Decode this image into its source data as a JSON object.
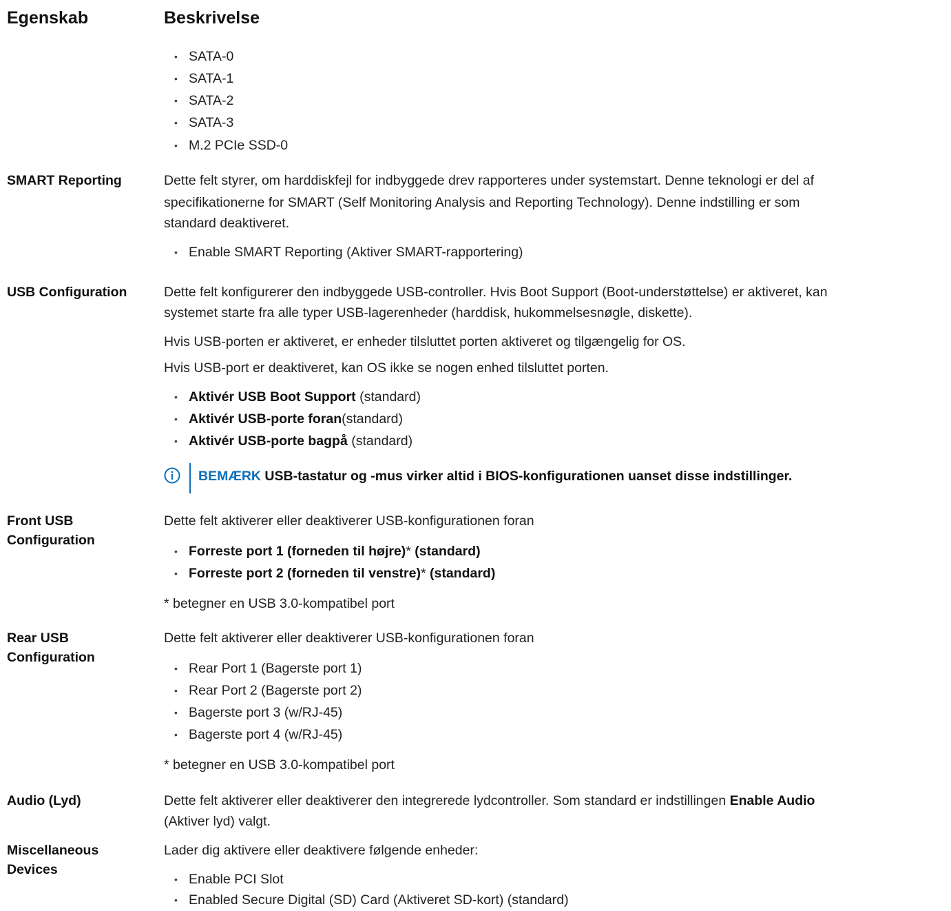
{
  "header": {
    "property": "Egenskab",
    "description": "Beskrivelse"
  },
  "storage_list": [
    "SATA-0",
    "SATA-1",
    "SATA-2",
    "SATA-3",
    "M.2 PCIe SSD-0"
  ],
  "smart": {
    "label": "SMART Reporting",
    "line1": "Dette felt styrer, om harddiskfejl for indbyggede drev rapporteres under systemstart. Denne teknologi er del af",
    "line2": "specifikationerne for SMART (Self Monitoring Analysis and Reporting Technology). Denne indstilling er som",
    "line3": "standard deaktiveret.",
    "option": "Enable SMART Reporting (Aktiver SMART-rapportering)"
  },
  "usb_config": {
    "label": "USB Configuration",
    "line1": "Dette felt konfigurerer den indbyggede USB-controller. Hvis Boot Support (Boot-understøttelse) er aktiveret, kan",
    "line2": "systemet starte fra alle typer USB-lagerenheder (harddisk, hukommelsesnøgle, diskette).",
    "para2": "Hvis USB-porten er aktiveret, er enheder tilsluttet porten aktiveret og tilgængelig for OS.",
    "para3": "Hvis USB-port er deaktiveret, kan OS ikke se nogen enhed tilsluttet porten.",
    "options": [
      {
        "bold": "Aktivér USB Boot Support",
        "rest": " (standard)"
      },
      {
        "bold": "Aktivér USB-porte foran",
        "rest": "(standard)"
      },
      {
        "bold": "Aktivér USB-porte bagpå",
        "rest": " (standard)"
      }
    ],
    "note_label": "BEMÆRK",
    "note_text": " USB-tastatur og -mus virker altid i BIOS-konfigurationen uanset disse indstillinger."
  },
  "front_usb": {
    "label_line1": "Front USB",
    "label_line2": "Configuration",
    "desc": "Dette felt aktiverer eller deaktiverer USB-konfigurationen foran",
    "options": [
      {
        "bold": "Forreste port 1 (forneden til højre)",
        "star": "*",
        "rest": " (standard)"
      },
      {
        "bold": "Forreste port 2 (forneden til venstre)",
        "star": "*",
        "rest": " (standard)"
      }
    ],
    "footnote": "* betegner en USB 3.0-kompatibel port"
  },
  "rear_usb": {
    "label_line1": "Rear USB",
    "label_line2": "Configuration",
    "desc": "Dette felt aktiverer eller deaktiverer USB-konfigurationen foran",
    "options": [
      "Rear Port 1 (Bagerste port 1)",
      "Rear Port 2 (Bagerste port 2)",
      "Bagerste port 3 (w/RJ-45)",
      "Bagerste port 4 (w/RJ-45)"
    ],
    "footnote": "* betegner en USB 3.0-kompatibel port"
  },
  "audio": {
    "label": "Audio (Lyd)",
    "line1_pre": "Dette felt aktiverer eller deaktiverer den integrerede lydcontroller. Som standard er indstillingen ",
    "line1_bold": "Enable Audio",
    "line2": "(Aktiver lyd) valgt."
  },
  "misc": {
    "label_line1": "Miscellaneous",
    "label_line2": "Devices",
    "desc": "Lader dig aktivere eller deaktivere følgende enheder:",
    "options": [
      "Enable PCI Slot",
      "Enabled Secure Digital (SD) Card (Aktiveret SD-kort) (standard)"
    ]
  },
  "colors": {
    "accent": "#0b6fb8",
    "text": "#222222"
  },
  "icons": {
    "note": "info-circle-icon",
    "bullet": "bullet-dot"
  }
}
